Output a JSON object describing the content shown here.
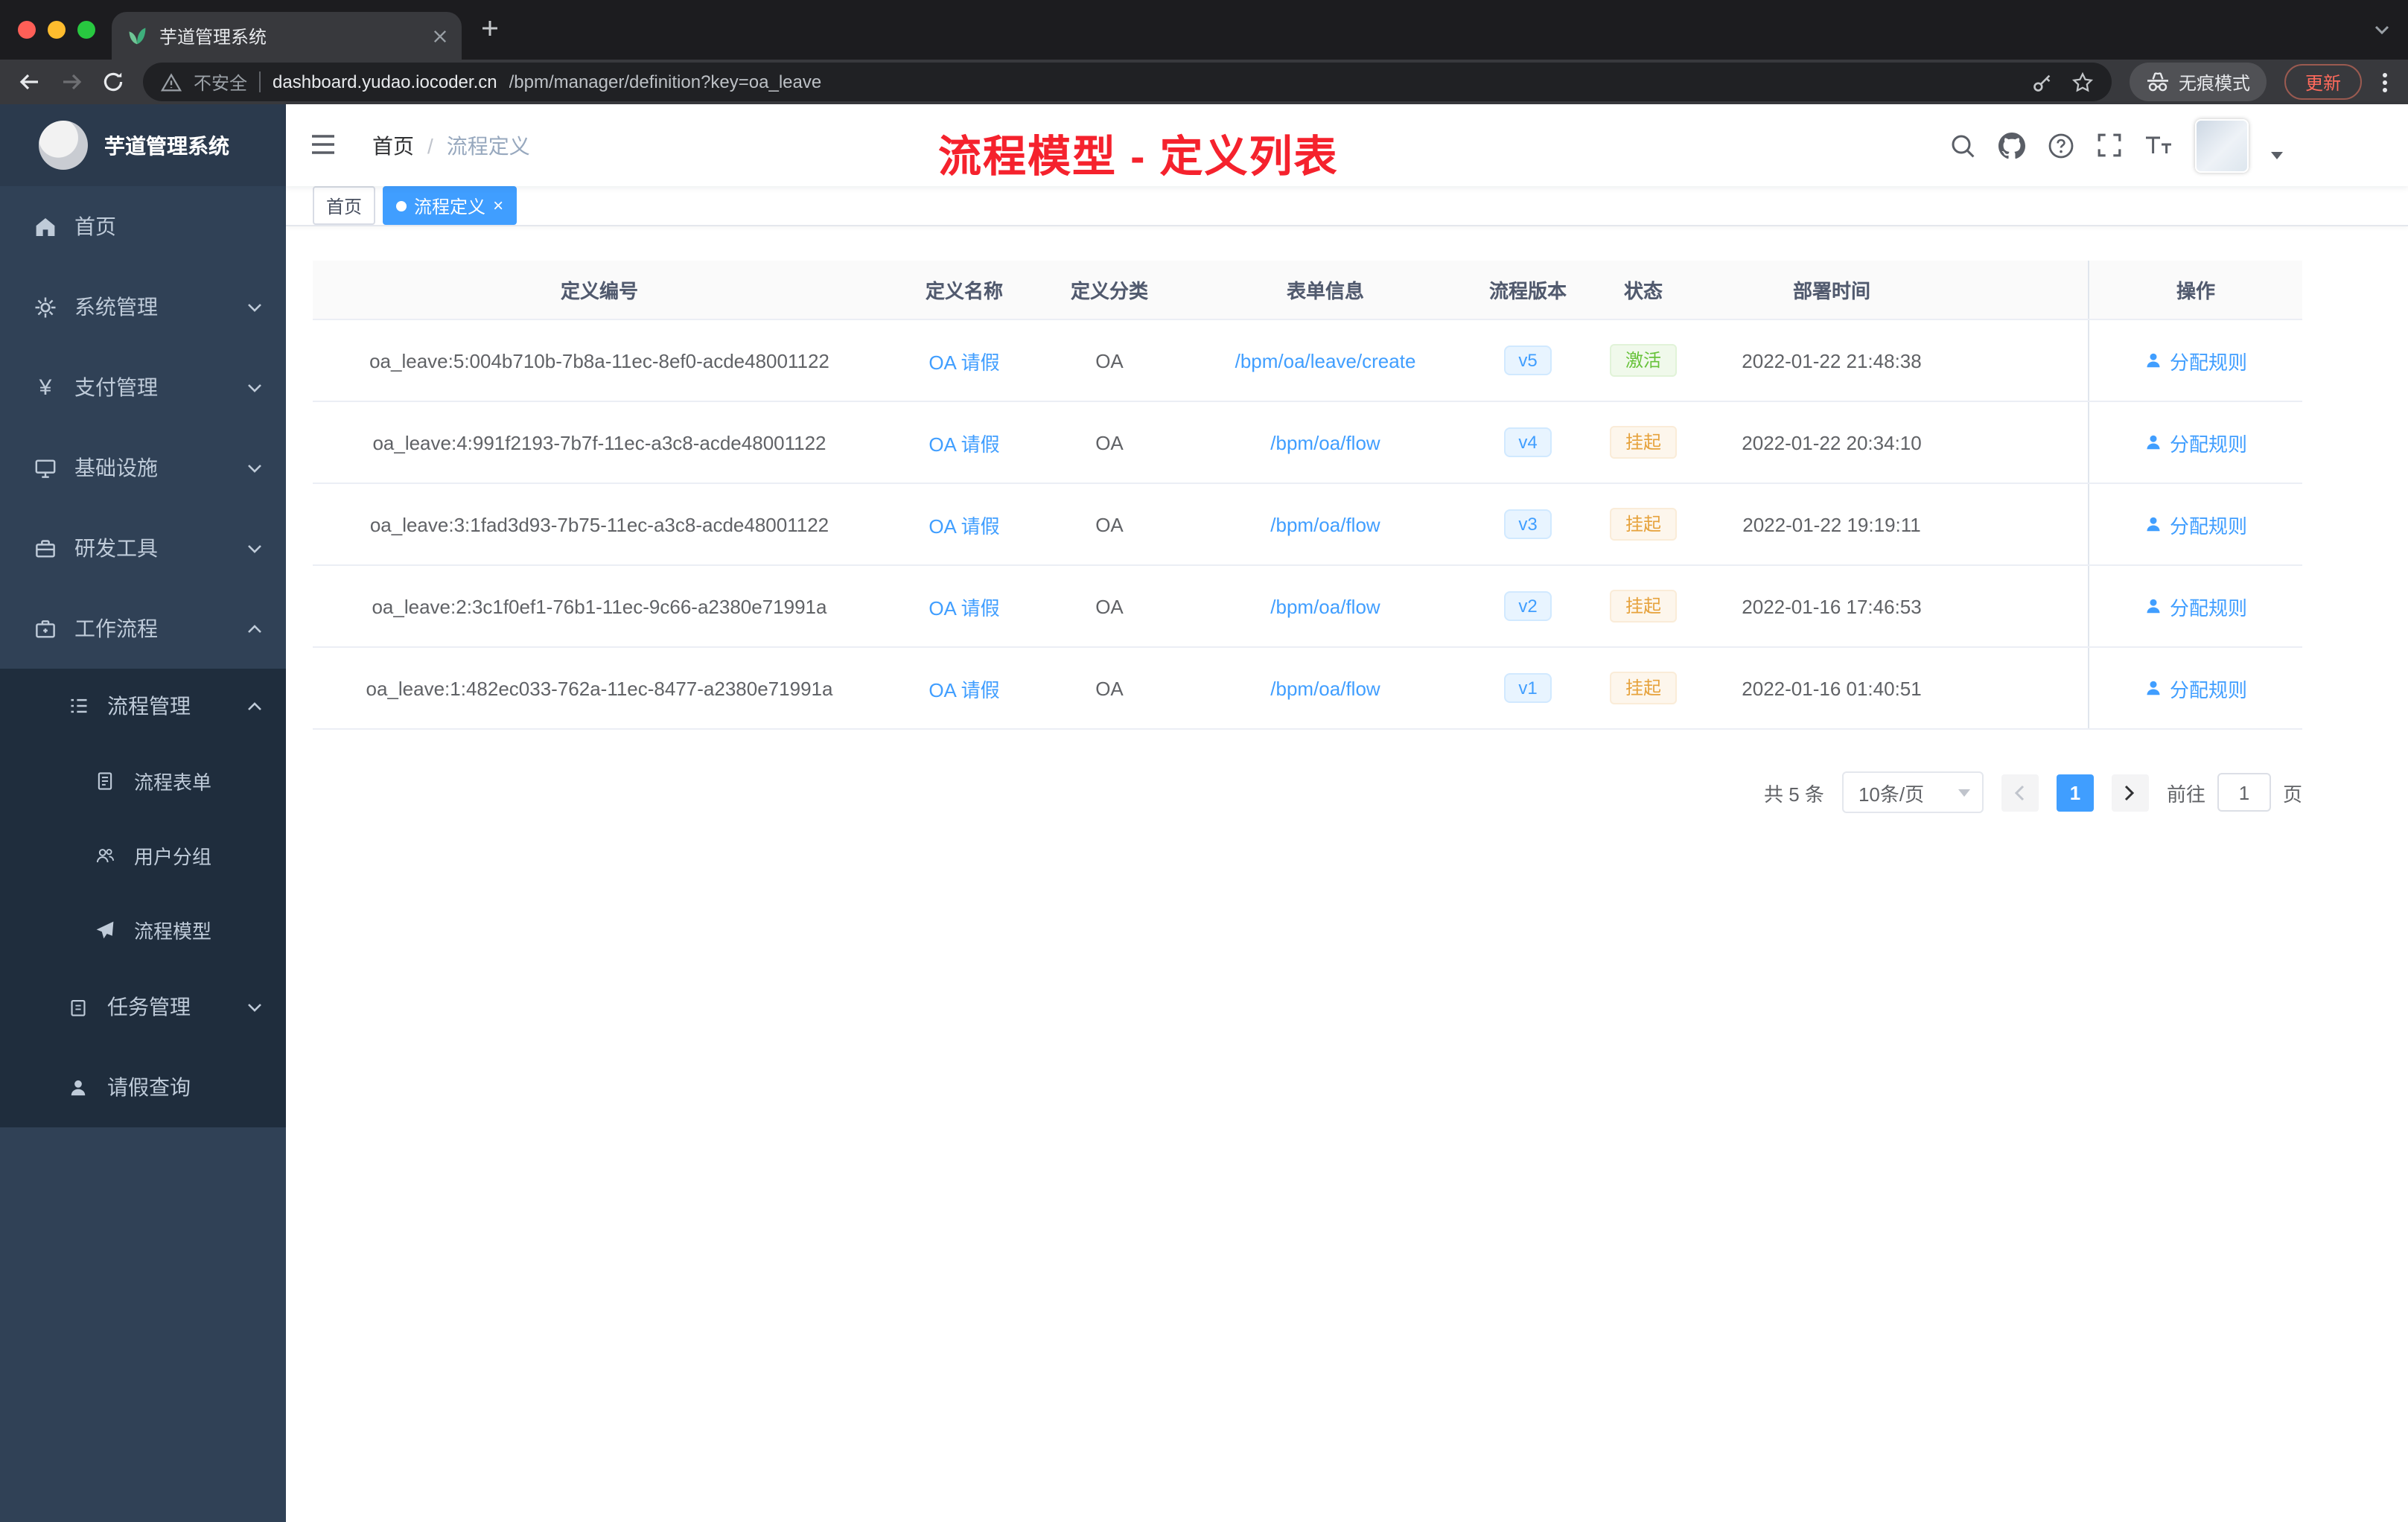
{
  "browser": {
    "tab_title": "芋道管理系统",
    "security_label": "不安全",
    "url_host": "dashboard.yudao.iocoder.cn",
    "url_path": "/bpm/manager/definition?key=oa_leave",
    "incognito_label": "无痕模式",
    "update_label": "更新"
  },
  "sidebar": {
    "app_title": "芋道管理系统",
    "items": [
      {
        "label": "首页",
        "icon": "home-icon"
      },
      {
        "label": "系统管理",
        "icon": "gear-icon"
      },
      {
        "label": "支付管理",
        "icon": "yen-icon"
      },
      {
        "label": "基础设施",
        "icon": "monitor-icon"
      },
      {
        "label": "研发工具",
        "icon": "toolbox-icon"
      },
      {
        "label": "工作流程",
        "icon": "briefcase-icon"
      },
      {
        "label": "流程管理",
        "icon": "list-icon"
      },
      {
        "label": "流程表单",
        "icon": "form-icon"
      },
      {
        "label": "用户分组",
        "icon": "users-icon"
      },
      {
        "label": "流程模型",
        "icon": "paper-plane-icon"
      },
      {
        "label": "任务管理",
        "icon": "clipboard-icon"
      },
      {
        "label": "请假查询",
        "icon": "user-icon"
      }
    ]
  },
  "header": {
    "breadcrumb_home": "首页",
    "breadcrumb_sep": "/",
    "breadcrumb_current": "流程定义",
    "annotation": "流程模型 - 定义列表"
  },
  "tags": {
    "home": "首页",
    "active": "流程定义"
  },
  "table": {
    "columns": [
      "定义编号",
      "定义名称",
      "定义分类",
      "表单信息",
      "流程版本",
      "状态",
      "部署时间",
      "操作"
    ],
    "rows": [
      {
        "id": "oa_leave:5:004b710b-7b8a-11ec-8ef0-acde48001122",
        "name": "OA 请假",
        "category": "OA",
        "form": "/bpm/oa/leave/create",
        "version": "v5",
        "status": "激活",
        "status_type": "success",
        "deploy_time": "2022-01-22 21:48:38",
        "action": "分配规则"
      },
      {
        "id": "oa_leave:4:991f2193-7b7f-11ec-a3c8-acde48001122",
        "name": "OA 请假",
        "category": "OA",
        "form": "/bpm/oa/flow",
        "version": "v4",
        "status": "挂起",
        "status_type": "warning",
        "deploy_time": "2022-01-22 20:34:10",
        "action": "分配规则"
      },
      {
        "id": "oa_leave:3:1fad3d93-7b75-11ec-a3c8-acde48001122",
        "name": "OA 请假",
        "category": "OA",
        "form": "/bpm/oa/flow",
        "version": "v3",
        "status": "挂起",
        "status_type": "warning",
        "deploy_time": "2022-01-22 19:19:11",
        "action": "分配规则"
      },
      {
        "id": "oa_leave:2:3c1f0ef1-76b1-11ec-9c66-a2380e71991a",
        "name": "OA 请假",
        "category": "OA",
        "form": "/bpm/oa/flow",
        "version": "v2",
        "status": "挂起",
        "status_type": "warning",
        "deploy_time": "2022-01-16 17:46:53",
        "action": "分配规则"
      },
      {
        "id": "oa_leave:1:482ec033-762a-11ec-8477-a2380e71991a",
        "name": "OA 请假",
        "category": "OA",
        "form": "/bpm/oa/flow",
        "version": "v1",
        "status": "挂起",
        "status_type": "warning",
        "deploy_time": "2022-01-16 01:40:51",
        "action": "分配规则"
      }
    ]
  },
  "pagination": {
    "total": "共 5 条",
    "page_size": "10条/页",
    "current_page": "1",
    "goto_label": "前往",
    "goto_value": "1",
    "unit": "页"
  },
  "colors": {
    "accent": "#409eff",
    "annotation_red": "#f5222d",
    "success": "#67c23a",
    "warning": "#e6a23c",
    "sidebar_bg": "#304156",
    "submenu_bg": "#1f2d3d"
  }
}
